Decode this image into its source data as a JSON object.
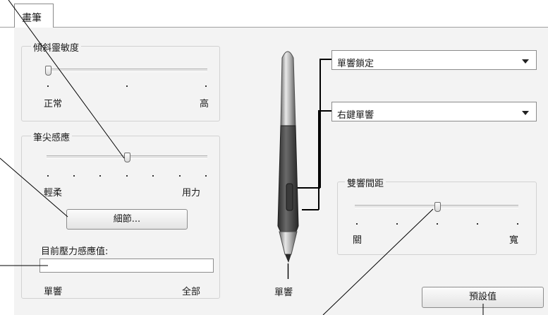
{
  "tab": {
    "label": "畫筆"
  },
  "tilt": {
    "title": "傾斜靈敏度",
    "min_label": "正常",
    "max_label": "高",
    "level": 0.0
  },
  "tip_feel": {
    "title": "筆尖感應",
    "min_label": "輕柔",
    "max_label": "用力",
    "level": 0.5,
    "details_button": "細節...",
    "pressure_label": "目前壓力感應值:",
    "pressure_min": "單響",
    "pressure_max": "全部",
    "pressure_value": 0
  },
  "pen": {
    "upper_button": "單響鎖定",
    "lower_button": "右鍵單響",
    "tip_label": "單響"
  },
  "double_click": {
    "title": "雙響間距",
    "min_label": "關",
    "max_label": "寬",
    "level": 0.5
  },
  "default_button": "預設值"
}
